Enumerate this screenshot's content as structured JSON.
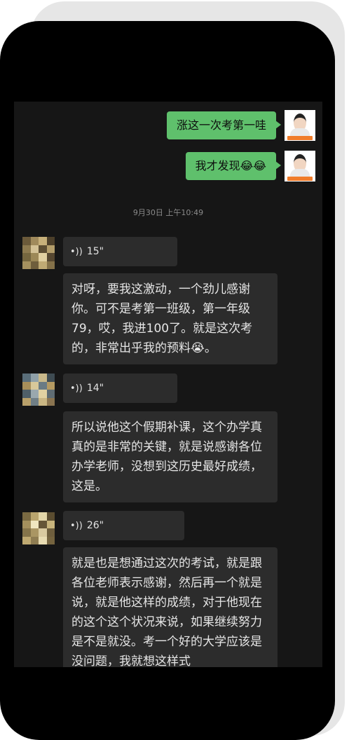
{
  "sent_messages": [
    {
      "text": "涨这一次考第一哇"
    },
    {
      "text": "我才发现😂😂"
    }
  ],
  "timestamp": "9月30日 上午10:49",
  "received": [
    {
      "voice_duration": "15\"",
      "transcript": "对呀，要我这激动，一个劲儿感谢你。可不是考第一班级，第一年级79，哎，我进100了。就是这次考的，非常出乎我的预料😭。"
    },
    {
      "voice_duration": "14\"",
      "transcript": "所以说他这个假期补课，这个办学真真的是非常的关键，就是说感谢各位办学老师，没想到这历史最好成绩，这是。"
    },
    {
      "voice_duration": "26\"",
      "transcript": "就是也是想通过这次的考试，就是跟各位老师表示感谢，然后再一个就是说，就是他这样的成绩，对于他现在的这个这个状况来说，如果继续努力是不是就没。考一个好的大学应该是没问题，我就想这样式"
    }
  ],
  "colors": {
    "sent_bubble": "#5fc06c",
    "received_bubble": "#2c2c2c",
    "chat_bg": "#161616"
  },
  "icons": {
    "voice": "voice-wave-icon"
  }
}
